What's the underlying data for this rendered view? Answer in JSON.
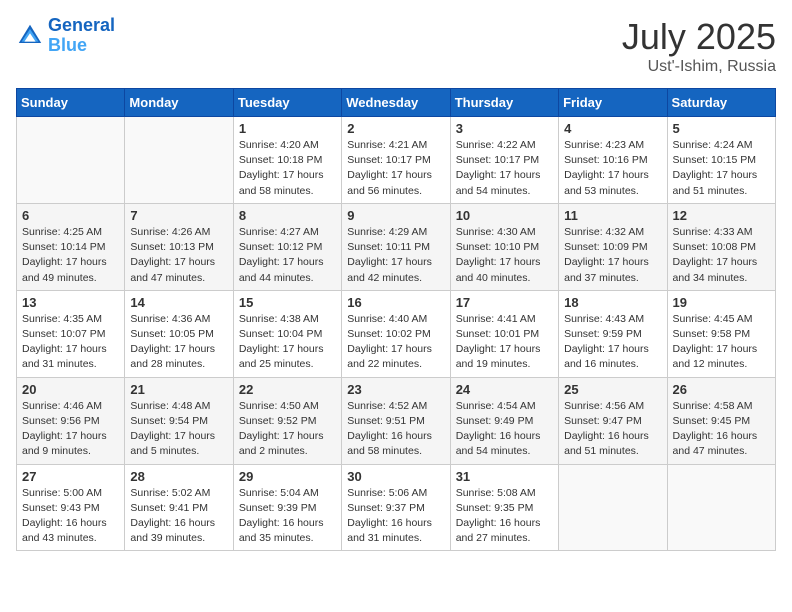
{
  "header": {
    "logo_line1": "General",
    "logo_line2": "Blue",
    "month": "July 2025",
    "location": "Ust'-Ishim, Russia"
  },
  "weekdays": [
    "Sunday",
    "Monday",
    "Tuesday",
    "Wednesday",
    "Thursday",
    "Friday",
    "Saturday"
  ],
  "weeks": [
    [
      {
        "day": "",
        "info": ""
      },
      {
        "day": "",
        "info": ""
      },
      {
        "day": "1",
        "info": "Sunrise: 4:20 AM\nSunset: 10:18 PM\nDaylight: 17 hours and 58 minutes."
      },
      {
        "day": "2",
        "info": "Sunrise: 4:21 AM\nSunset: 10:17 PM\nDaylight: 17 hours and 56 minutes."
      },
      {
        "day": "3",
        "info": "Sunrise: 4:22 AM\nSunset: 10:17 PM\nDaylight: 17 hours and 54 minutes."
      },
      {
        "day": "4",
        "info": "Sunrise: 4:23 AM\nSunset: 10:16 PM\nDaylight: 17 hours and 53 minutes."
      },
      {
        "day": "5",
        "info": "Sunrise: 4:24 AM\nSunset: 10:15 PM\nDaylight: 17 hours and 51 minutes."
      }
    ],
    [
      {
        "day": "6",
        "info": "Sunrise: 4:25 AM\nSunset: 10:14 PM\nDaylight: 17 hours and 49 minutes."
      },
      {
        "day": "7",
        "info": "Sunrise: 4:26 AM\nSunset: 10:13 PM\nDaylight: 17 hours and 47 minutes."
      },
      {
        "day": "8",
        "info": "Sunrise: 4:27 AM\nSunset: 10:12 PM\nDaylight: 17 hours and 44 minutes."
      },
      {
        "day": "9",
        "info": "Sunrise: 4:29 AM\nSunset: 10:11 PM\nDaylight: 17 hours and 42 minutes."
      },
      {
        "day": "10",
        "info": "Sunrise: 4:30 AM\nSunset: 10:10 PM\nDaylight: 17 hours and 40 minutes."
      },
      {
        "day": "11",
        "info": "Sunrise: 4:32 AM\nSunset: 10:09 PM\nDaylight: 17 hours and 37 minutes."
      },
      {
        "day": "12",
        "info": "Sunrise: 4:33 AM\nSunset: 10:08 PM\nDaylight: 17 hours and 34 minutes."
      }
    ],
    [
      {
        "day": "13",
        "info": "Sunrise: 4:35 AM\nSunset: 10:07 PM\nDaylight: 17 hours and 31 minutes."
      },
      {
        "day": "14",
        "info": "Sunrise: 4:36 AM\nSunset: 10:05 PM\nDaylight: 17 hours and 28 minutes."
      },
      {
        "day": "15",
        "info": "Sunrise: 4:38 AM\nSunset: 10:04 PM\nDaylight: 17 hours and 25 minutes."
      },
      {
        "day": "16",
        "info": "Sunrise: 4:40 AM\nSunset: 10:02 PM\nDaylight: 17 hours and 22 minutes."
      },
      {
        "day": "17",
        "info": "Sunrise: 4:41 AM\nSunset: 10:01 PM\nDaylight: 17 hours and 19 minutes."
      },
      {
        "day": "18",
        "info": "Sunrise: 4:43 AM\nSunset: 9:59 PM\nDaylight: 17 hours and 16 minutes."
      },
      {
        "day": "19",
        "info": "Sunrise: 4:45 AM\nSunset: 9:58 PM\nDaylight: 17 hours and 12 minutes."
      }
    ],
    [
      {
        "day": "20",
        "info": "Sunrise: 4:46 AM\nSunset: 9:56 PM\nDaylight: 17 hours and 9 minutes."
      },
      {
        "day": "21",
        "info": "Sunrise: 4:48 AM\nSunset: 9:54 PM\nDaylight: 17 hours and 5 minutes."
      },
      {
        "day": "22",
        "info": "Sunrise: 4:50 AM\nSunset: 9:52 PM\nDaylight: 17 hours and 2 minutes."
      },
      {
        "day": "23",
        "info": "Sunrise: 4:52 AM\nSunset: 9:51 PM\nDaylight: 16 hours and 58 minutes."
      },
      {
        "day": "24",
        "info": "Sunrise: 4:54 AM\nSunset: 9:49 PM\nDaylight: 16 hours and 54 minutes."
      },
      {
        "day": "25",
        "info": "Sunrise: 4:56 AM\nSunset: 9:47 PM\nDaylight: 16 hours and 51 minutes."
      },
      {
        "day": "26",
        "info": "Sunrise: 4:58 AM\nSunset: 9:45 PM\nDaylight: 16 hours and 47 minutes."
      }
    ],
    [
      {
        "day": "27",
        "info": "Sunrise: 5:00 AM\nSunset: 9:43 PM\nDaylight: 16 hours and 43 minutes."
      },
      {
        "day": "28",
        "info": "Sunrise: 5:02 AM\nSunset: 9:41 PM\nDaylight: 16 hours and 39 minutes."
      },
      {
        "day": "29",
        "info": "Sunrise: 5:04 AM\nSunset: 9:39 PM\nDaylight: 16 hours and 35 minutes."
      },
      {
        "day": "30",
        "info": "Sunrise: 5:06 AM\nSunset: 9:37 PM\nDaylight: 16 hours and 31 minutes."
      },
      {
        "day": "31",
        "info": "Sunrise: 5:08 AM\nSunset: 9:35 PM\nDaylight: 16 hours and 27 minutes."
      },
      {
        "day": "",
        "info": ""
      },
      {
        "day": "",
        "info": ""
      }
    ]
  ]
}
